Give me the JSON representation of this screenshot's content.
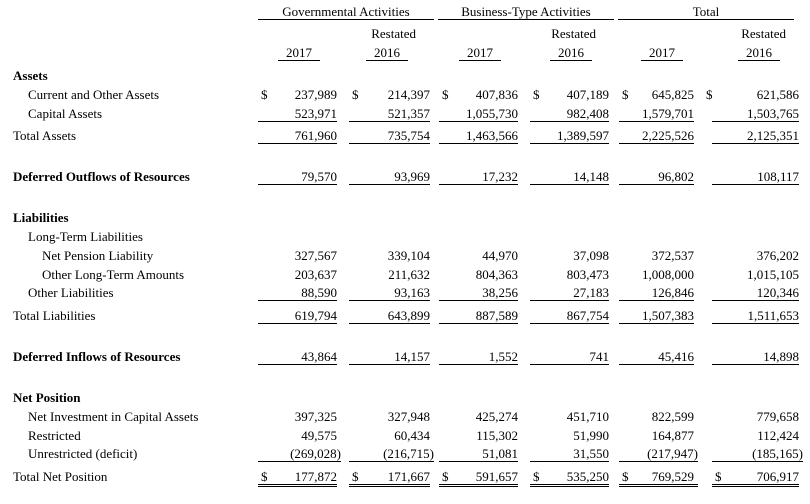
{
  "headers": {
    "groups": [
      "Governmental Activities",
      "Business-Type Activities",
      "Total"
    ],
    "restated": "Restated",
    "years": [
      "2017",
      "2016",
      "2017",
      "2016",
      "2017",
      "2016"
    ]
  },
  "currency": "$",
  "sections": {
    "assets": "Assets",
    "deferred_outflows": "Deferred Outflows of Resources",
    "liabilities": "Liabilities",
    "long_term": "Long-Term Liabilities",
    "deferred_inflows": "Deferred Inflows of Resources",
    "net_position": "Net Position"
  },
  "rows": {
    "current_assets": {
      "label": "Current and Other Assets",
      "values": [
        "237,989",
        "214,397",
        "407,836",
        "407,189",
        "645,825",
        "621,586"
      ]
    },
    "capital_assets": {
      "label": "Capital Assets",
      "values": [
        "523,971",
        "521,357",
        "1,055,730",
        "982,408",
        "1,579,701",
        "1,503,765"
      ]
    },
    "total_assets": {
      "label": "Total Assets",
      "values": [
        "761,960",
        "735,754",
        "1,463,566",
        "1,389,597",
        "2,225,526",
        "2,125,351"
      ]
    },
    "deferred_outflows": {
      "values": [
        "79,570",
        "93,969",
        "17,232",
        "14,148",
        "96,802",
        "108,117"
      ]
    },
    "net_pension": {
      "label": "Net Pension Liability",
      "values": [
        "327,567",
        "339,104",
        "44,970",
        "37,098",
        "372,537",
        "376,202"
      ]
    },
    "other_long_term": {
      "label": "Other Long-Term Amounts",
      "values": [
        "203,637",
        "211,632",
        "804,363",
        "803,473",
        "1,008,000",
        "1,015,105"
      ]
    },
    "other_liabilities": {
      "label": "Other Liabilities",
      "values": [
        "88,590",
        "93,163",
        "38,256",
        "27,183",
        "126,846",
        "120,346"
      ]
    },
    "total_liabilities": {
      "label": "Total Liabilities",
      "values": [
        "619,794",
        "643,899",
        "887,589",
        "867,754",
        "1,507,383",
        "1,511,653"
      ]
    },
    "deferred_inflows": {
      "values": [
        "43,864",
        "14,157",
        "1,552",
        "741",
        "45,416",
        "14,898"
      ]
    },
    "net_investment": {
      "label": "Net Investment in Capital Assets",
      "values": [
        "397,325",
        "327,948",
        "425,274",
        "451,710",
        "822,599",
        "779,658"
      ]
    },
    "restricted": {
      "label": "Restricted",
      "values": [
        "49,575",
        "60,434",
        "115,302",
        "51,990",
        "164,877",
        "112,424"
      ]
    },
    "unrestricted": {
      "label": "Unrestricted (deficit)",
      "values": [
        "(269,028)",
        "(216,715)",
        "51,081",
        "31,550",
        "(217,947)",
        "(185,165)"
      ]
    },
    "total_net_position": {
      "label": "Total Net Position",
      "values": [
        "177,872",
        "171,667",
        "591,657",
        "535,250",
        "769,529",
        "706,917"
      ]
    }
  }
}
